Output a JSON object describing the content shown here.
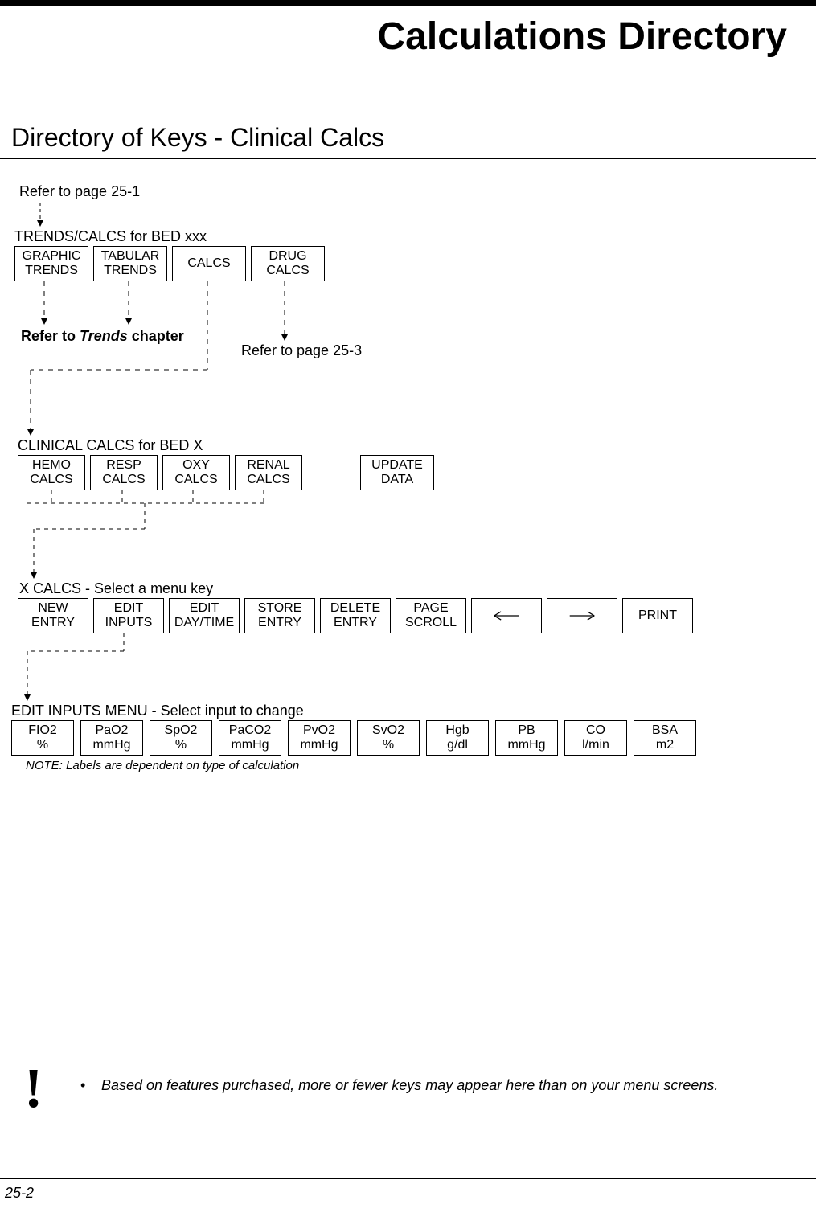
{
  "title": "Calculations Directory",
  "section_title": "Directory of Keys - Clinical Calcs",
  "ref_top": "Refer to page 25-1",
  "menu1": {
    "caption": "TRENDS/CALCS for BED xxx",
    "items": [
      {
        "l1": "GRAPHIC",
        "l2": "TRENDS"
      },
      {
        "l1": "TABULAR",
        "l2": "TRENDS"
      },
      {
        "l1": "CALCS",
        "l2": ""
      },
      {
        "l1": "DRUG",
        "l2": "CALCS"
      }
    ]
  },
  "ref_trends_a": "Refer to ",
  "ref_trends_b": "Trends",
  "ref_trends_c": " chapter",
  "ref_drug": "Refer to page 25-3",
  "menu2": {
    "caption": "CLINICAL CALCS for BED X",
    "items": [
      {
        "l1": "HEMO",
        "l2": "CALCS"
      },
      {
        "l1": "RESP",
        "l2": "CALCS"
      },
      {
        "l1": "OXY",
        "l2": "CALCS"
      },
      {
        "l1": "RENAL",
        "l2": "CALCS"
      }
    ],
    "update": {
      "l1": "UPDATE",
      "l2": "DATA"
    }
  },
  "menu3": {
    "caption": "X CALCS - Select a menu key",
    "items": [
      {
        "l1": "NEW",
        "l2": "ENTRY"
      },
      {
        "l1": "EDIT",
        "l2": "INPUTS"
      },
      {
        "l1": "EDIT",
        "l2": "DAY/TIME"
      },
      {
        "l1": "STORE",
        "l2": "ENTRY"
      },
      {
        "l1": "DELETE",
        "l2": "ENTRY"
      },
      {
        "l1": "PAGE",
        "l2": "SCROLL"
      },
      {
        "arrow": "left"
      },
      {
        "arrow": "right"
      },
      {
        "l1": "PRINT",
        "l2": ""
      }
    ]
  },
  "menu4": {
    "caption": "EDIT INPUTS MENU - Select input to change",
    "items": [
      {
        "l1": "FIO2",
        "l2": "%"
      },
      {
        "l1": "PaO2",
        "l2": "mmHg"
      },
      {
        "l1": "SpO2",
        "l2": "%"
      },
      {
        "l1": "PaCO2",
        "l2": "mmHg"
      },
      {
        "l1": "PvO2",
        "l2": "mmHg"
      },
      {
        "l1": "SvO2",
        "l2": "%"
      },
      {
        "l1": "Hgb",
        "l2": "g/dl"
      },
      {
        "l1": "PB",
        "l2": "mmHg"
      },
      {
        "l1": "CO",
        "l2": "l/min"
      },
      {
        "l1": "BSA",
        "l2": "m2"
      }
    ],
    "note": "NOTE: Labels are dependent on type of calculation"
  },
  "footer_note": "Based on features purchased, more or fewer keys may appear here than on your menu screens.",
  "page_num": "25-2"
}
